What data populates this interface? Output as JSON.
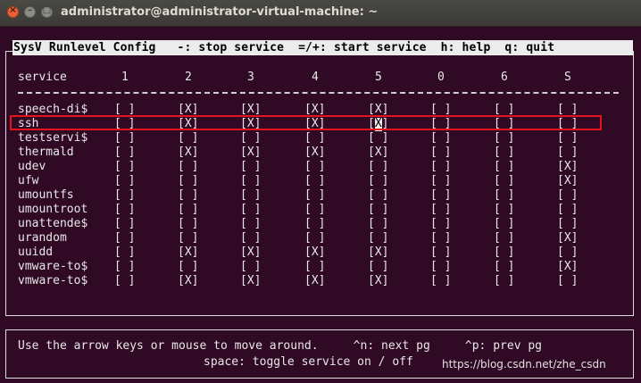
{
  "window": {
    "title": "administrator@administrator-virtual-machine: ~"
  },
  "app": {
    "header": "SysV Runlevel Config   -: stop service  =/+: start service  h: help  q: quit"
  },
  "columns": [
    "service",
    "1",
    "2",
    "3",
    "4",
    "5",
    "0",
    "6",
    "S"
  ],
  "rows": [
    {
      "name": "speech-di$",
      "states": [
        " ",
        "X",
        "X",
        "X",
        "X",
        " ",
        " ",
        " "
      ]
    },
    {
      "name": "ssh",
      "states": [
        " ",
        "X",
        "X",
        "X",
        "X",
        " ",
        " ",
        " "
      ]
    },
    {
      "name": "testservi$",
      "states": [
        " ",
        " ",
        " ",
        " ",
        " ",
        " ",
        " ",
        " "
      ]
    },
    {
      "name": "thermald",
      "states": [
        " ",
        "X",
        "X",
        "X",
        "X",
        " ",
        " ",
        " "
      ]
    },
    {
      "name": "udev",
      "states": [
        " ",
        " ",
        " ",
        " ",
        " ",
        " ",
        " ",
        "X"
      ]
    },
    {
      "name": "ufw",
      "states": [
        " ",
        " ",
        " ",
        " ",
        " ",
        " ",
        " ",
        "X"
      ]
    },
    {
      "name": "umountfs",
      "states": [
        " ",
        " ",
        " ",
        " ",
        " ",
        " ",
        " ",
        " "
      ]
    },
    {
      "name": "umountroot",
      "states": [
        " ",
        " ",
        " ",
        " ",
        " ",
        " ",
        " ",
        " "
      ]
    },
    {
      "name": "unattende$",
      "states": [
        " ",
        " ",
        " ",
        " ",
        " ",
        " ",
        " ",
        " "
      ]
    },
    {
      "name": "urandom",
      "states": [
        " ",
        " ",
        " ",
        " ",
        " ",
        " ",
        " ",
        "X"
      ]
    },
    {
      "name": "uuidd",
      "states": [
        " ",
        "X",
        "X",
        "X",
        "X",
        " ",
        " ",
        " "
      ]
    },
    {
      "name": "vmware-to$",
      "states": [
        " ",
        " ",
        " ",
        " ",
        " ",
        " ",
        " ",
        "X"
      ]
    },
    {
      "name": "vmware-to$",
      "states": [
        " ",
        "X",
        "X",
        "X",
        "X",
        " ",
        " ",
        " "
      ]
    }
  ],
  "selected": {
    "row": 1,
    "col": 4
  },
  "footer": {
    "line1": "Use the arrow keys or mouse to move around.     ^n: next pg     ^p: prev pg",
    "line2": "space: toggle service on / off"
  },
  "watermark": "https://blog.csdn.net/zhe_csdn",
  "colors": {
    "terminal_bg": "#300a24",
    "highlight": "#e5141c",
    "close_button": "#e8603a"
  }
}
